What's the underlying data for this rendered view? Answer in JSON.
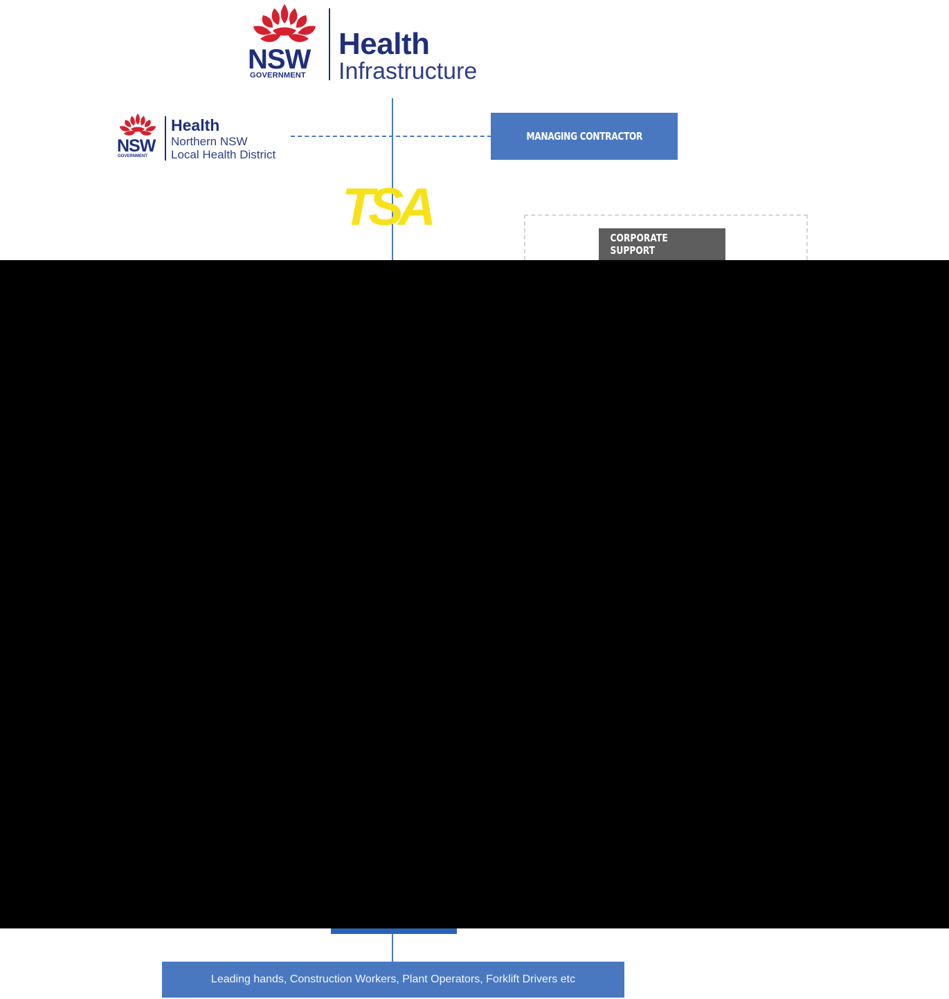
{
  "logos": {
    "health_infrastructure": {
      "nsw": "NSW",
      "government": "GOVERNMENT",
      "title": "Health",
      "subtitle": "Infrastructure",
      "icon": "waratah-flower-icon"
    },
    "local_health_district": {
      "nsw": "NSW",
      "government": "GOVERNMENT",
      "title": "Health",
      "line1": "Northern NSW",
      "line2": "Local Health District",
      "icon": "waratah-flower-icon"
    },
    "tsa": {
      "text": "TSA"
    }
  },
  "nodes": {
    "managing_contractor": "MANAGING CONTRACTOR",
    "corporate_support": "CORPORATE SUPPORT",
    "workers": "Leading hands, Construction Workers, Plant Operators, Forklift Drivers etc"
  },
  "colors": {
    "primary_blue": "#4a78c0",
    "navy": "#1f2f7a",
    "waratah_red": "#d6202e",
    "tsa_yellow": "#f7e21a",
    "corporate_grey": "#5e5e5e",
    "redaction": "#000000"
  }
}
